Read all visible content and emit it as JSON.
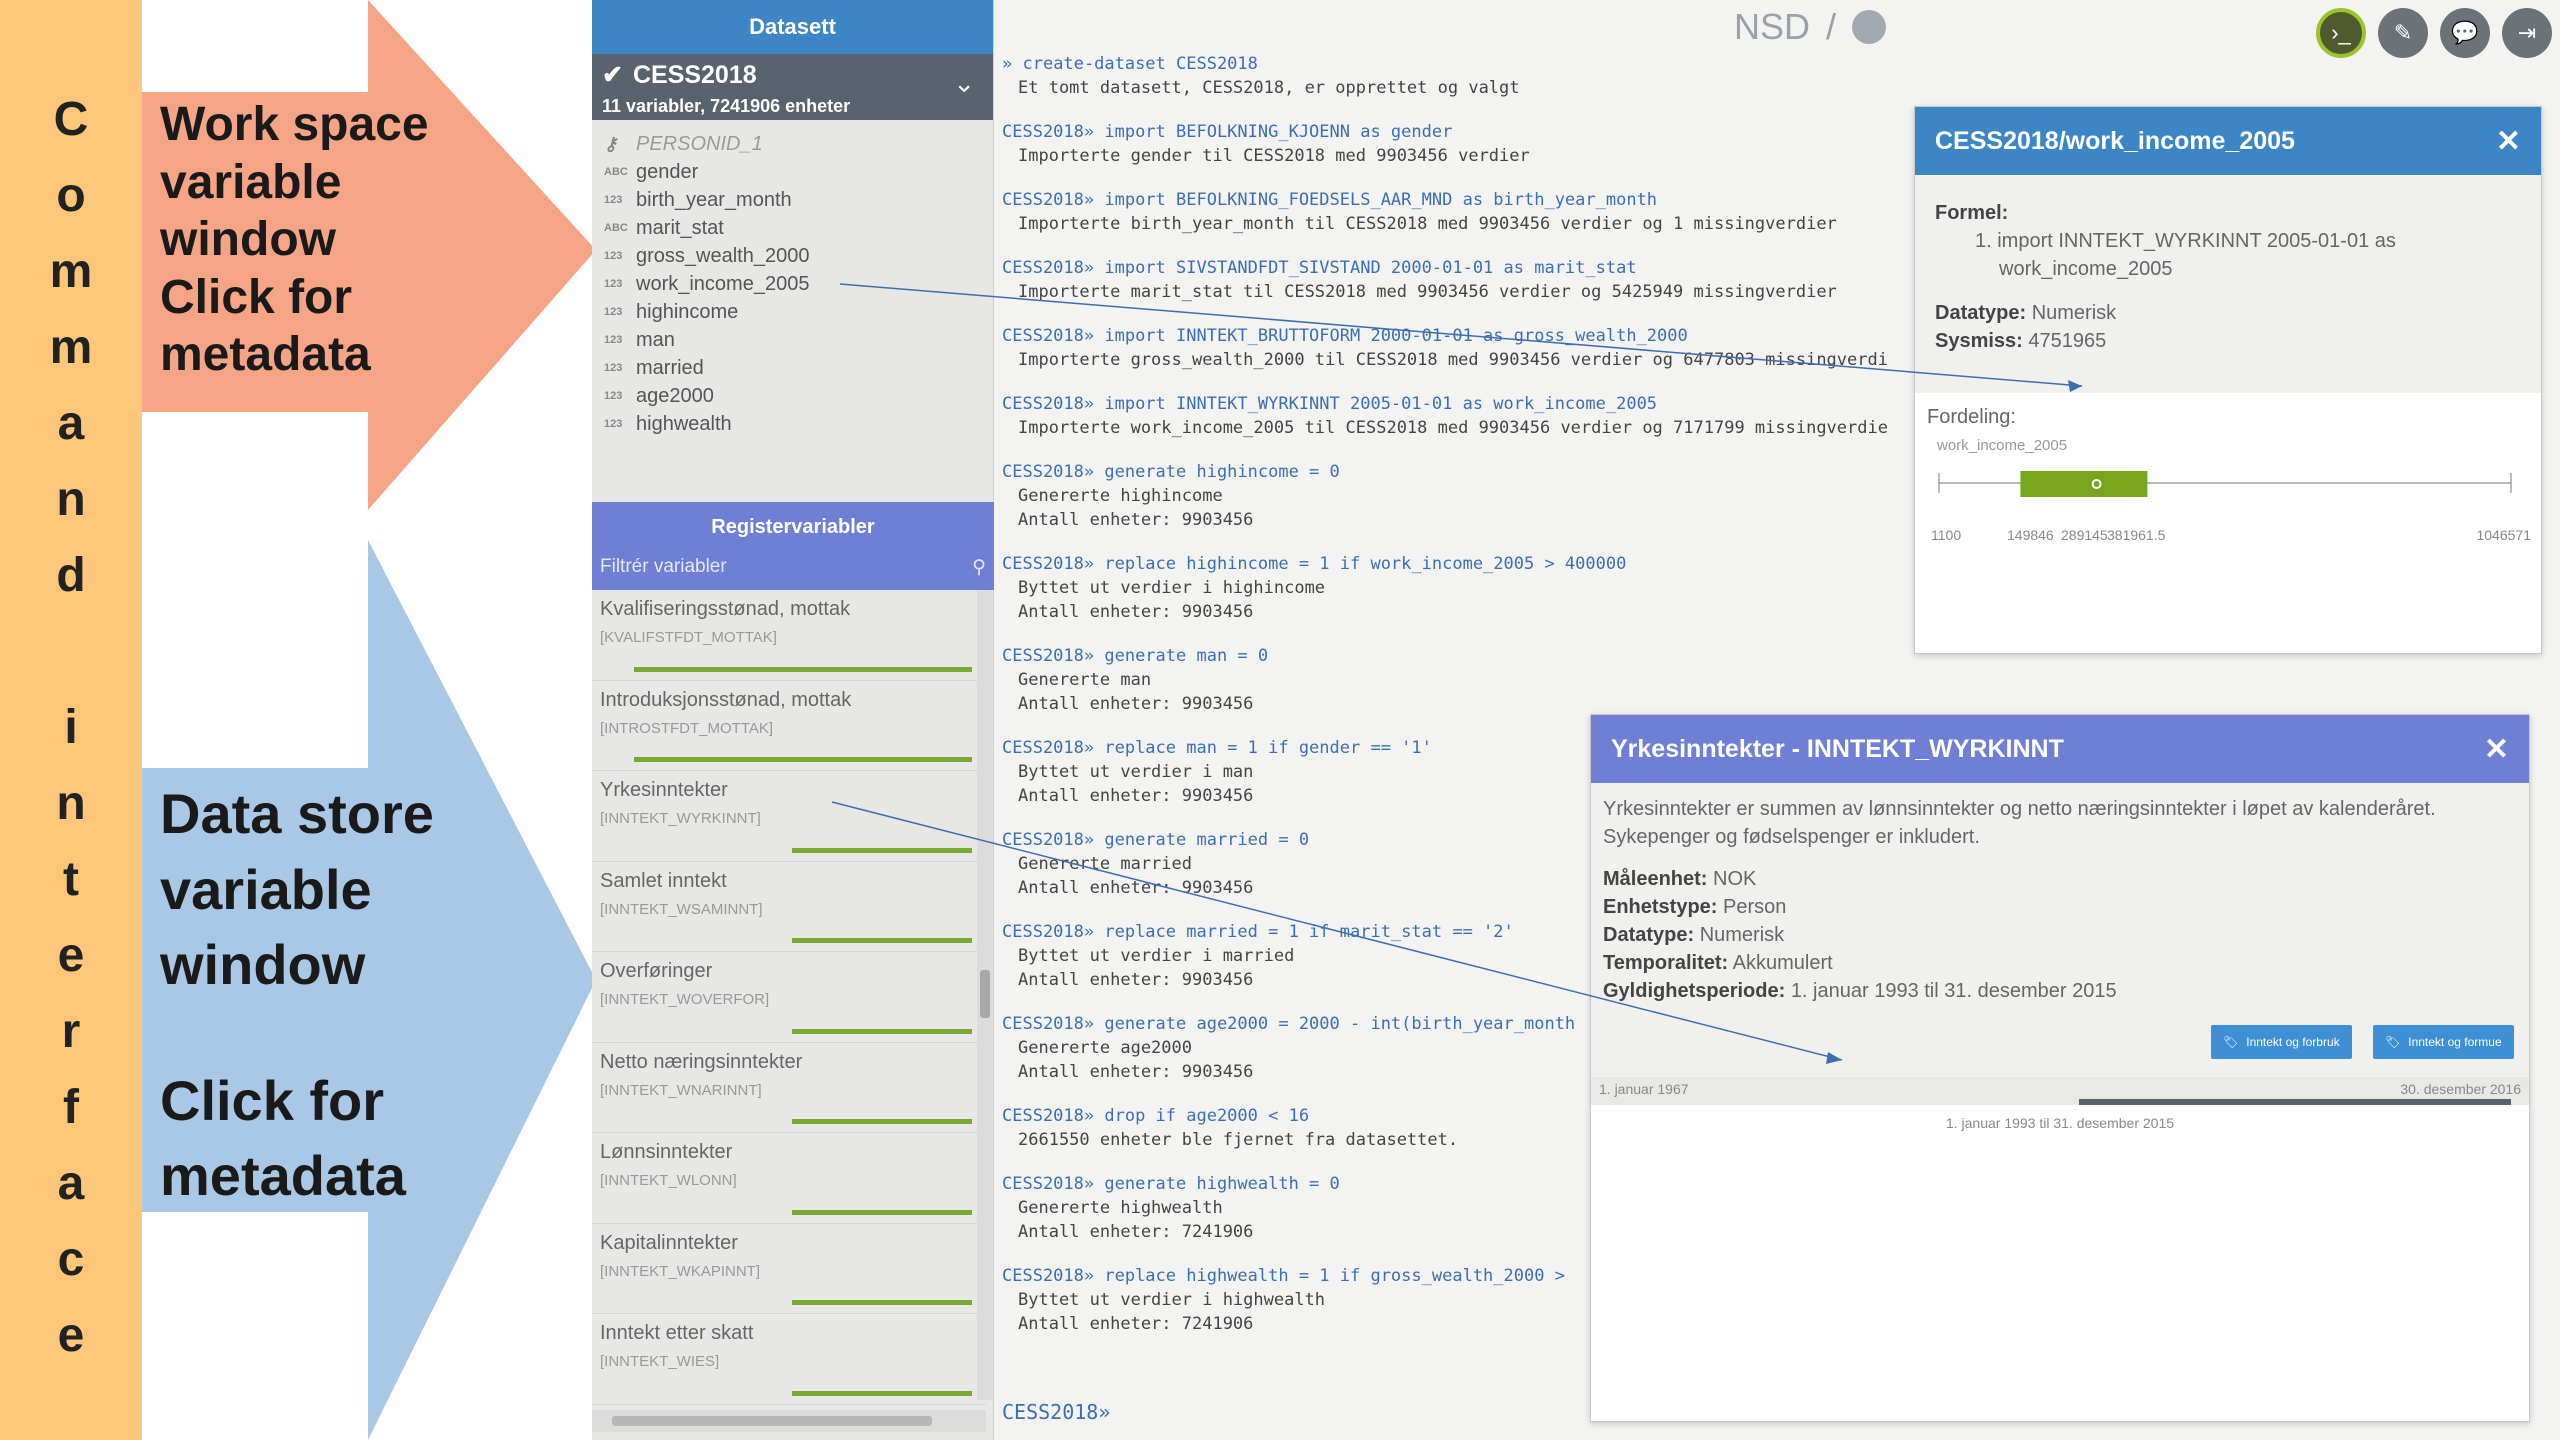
{
  "annotations": {
    "command_letters": [
      "C",
      "o",
      "m",
      "m",
      "a",
      "n",
      "d",
      "",
      "i",
      "n",
      "t",
      "e",
      "r",
      "f",
      "a",
      "c",
      "e"
    ],
    "workspace_label": [
      "Work space",
      "variable",
      "window",
      "Click for",
      "metadata"
    ],
    "datastore_label": [
      "Data store",
      "variable",
      "window",
      "",
      "Click for",
      "metadata"
    ],
    "colors": {
      "command_bar": "#fdc77a",
      "workspace_arrow": "#f5a585",
      "datastore_arrow": "#a8c8e6"
    }
  },
  "dataset": {
    "header": "Datasett",
    "name": "CESS2018",
    "summary": "11 variabler, 7241906 enheter",
    "variables": [
      {
        "type": "key",
        "name": "PERSONID_1"
      },
      {
        "type": "ABC",
        "name": "gender"
      },
      {
        "type": "123",
        "name": "birth_year_month"
      },
      {
        "type": "ABC",
        "name": "marit_stat"
      },
      {
        "type": "123",
        "name": "gross_wealth_2000"
      },
      {
        "type": "123",
        "name": "work_income_2005"
      },
      {
        "type": "123",
        "name": "highincome"
      },
      {
        "type": "123",
        "name": "man"
      },
      {
        "type": "123",
        "name": "married"
      },
      {
        "type": "123",
        "name": "age2000"
      },
      {
        "type": "123",
        "name": "highwealth"
      }
    ]
  },
  "register": {
    "header": "Registervariabler",
    "filter_placeholder": "Filtrér variabler",
    "items": [
      {
        "name": "Kvalifiseringsstønad, mottak",
        "code": "[KVALIFSTFDT_MOTTAK]",
        "coverage": 0.94
      },
      {
        "name": "Introduksjonsstønad, mottak",
        "code": "[INTROSTFDT_MOTTAK]",
        "coverage": 0.94
      },
      {
        "name": "Yrkesinntekter",
        "code": "[INNTEKT_WYRKINNT]",
        "coverage": 0.5
      },
      {
        "name": "Samlet inntekt",
        "code": "[INNTEKT_WSAMINNT]",
        "coverage": 0.5
      },
      {
        "name": "Overføringer",
        "code": "[INNTEKT_WOVERFOR]",
        "coverage": 0.5
      },
      {
        "name": "Netto næringsinntekter",
        "code": "[INNTEKT_WNARINNT]",
        "coverage": 0.5
      },
      {
        "name": "Lønnsinntekter",
        "code": "[INNTEKT_WLONN]",
        "coverage": 0.5
      },
      {
        "name": "Kapitalinntekter",
        "code": "[INNTEKT_WKAPINNT]",
        "coverage": 0.5
      },
      {
        "name": "Inntekt etter skatt",
        "code": "[INNTEKT_WIES]",
        "coverage": 0.5
      }
    ]
  },
  "topbar": {
    "brand": "NSD",
    "separator": "/"
  },
  "console": {
    "blocks": [
      {
        "prompt": "»",
        "cmd": " create-dataset CESS2018",
        "out": [
          "Et tomt datasett, CESS2018, er opprettet og valgt"
        ]
      },
      {
        "prompt": "CESS2018»",
        "cmd": " import BEFOLKNING_KJOENN as gender",
        "out": [
          "Importerte gender til CESS2018 med 9903456 verdier"
        ]
      },
      {
        "prompt": "CESS2018»",
        "cmd": " import BEFOLKNING_FOEDSELS_AAR_MND as birth_year_month",
        "out": [
          "Importerte birth_year_month til CESS2018 med 9903456 verdier og 1 missingverdier"
        ]
      },
      {
        "prompt": "CESS2018»",
        "cmd": " import SIVSTANDFDT_SIVSTAND 2000-01-01 as marit_stat",
        "out": [
          "Importerte marit_stat til CESS2018 med 9903456 verdier og 5425949 missingverdier"
        ]
      },
      {
        "prompt": "CESS2018»",
        "cmd": " import INNTEKT_BRUTTOFORM 2000-01-01 as gross_wealth_2000",
        "out": [
          "Importerte gross_wealth_2000 til CESS2018 med 9903456 verdier og 6477803 missingverdi"
        ]
      },
      {
        "prompt": "CESS2018»",
        "cmd": " import INNTEKT_WYRKINNT 2005-01-01 as work_income_2005",
        "out": [
          "Importerte work_income_2005 til CESS2018 med 9903456 verdier og 7171799 missingverdie"
        ]
      },
      {
        "prompt": "CESS2018»",
        "cmd": " generate highincome = 0",
        "out": [
          "Genererte highincome",
          "Antall enheter: 9903456"
        ]
      },
      {
        "prompt": "CESS2018»",
        "cmd": " replace highincome = 1 if work_income_2005 > 400000",
        "out": [
          "Byttet ut verdier i highincome",
          "Antall enheter: 9903456"
        ]
      },
      {
        "prompt": "CESS2018»",
        "cmd": " generate man = 0",
        "out": [
          "Genererte man",
          "Antall enheter: 9903456"
        ]
      },
      {
        "prompt": "CESS2018»",
        "cmd": " replace man = 1 if gender == '1'",
        "out": [
          "Byttet ut verdier i man",
          "Antall enheter: 9903456"
        ]
      },
      {
        "prompt": "CESS2018»",
        "cmd": " generate married = 0",
        "out": [
          "Genererte married",
          "Antall enheter: 9903456"
        ]
      },
      {
        "prompt": "CESS2018»",
        "cmd": " replace married = 1 if marit_stat == '2'",
        "out": [
          "Byttet ut verdier i married",
          "Antall enheter: 9903456"
        ]
      },
      {
        "prompt": "CESS2018»",
        "cmd": " generate age2000 = 2000 - int(birth_year_month",
        "out": [
          "Genererte age2000",
          "Antall enheter: 9903456"
        ]
      },
      {
        "prompt": "CESS2018»",
        "cmd": " drop if age2000 < 16",
        "out": [
          "2661550 enheter ble fjernet fra datasettet."
        ]
      },
      {
        "prompt": "CESS2018»",
        "cmd": " generate highwealth = 0",
        "out": [
          "Genererte highwealth",
          "Antall enheter: 7241906"
        ]
      },
      {
        "prompt": "CESS2018»",
        "cmd": " replace highwealth = 1 if gross_wealth_2000 >",
        "out": [
          "Byttet ut verdier i highwealth",
          "Antall enheter: 7241906"
        ]
      }
    ],
    "current_prompt": "CESS2018»"
  },
  "popup_workspace": {
    "title": "CESS2018/work_income_2005",
    "formula_label": "Formel:",
    "formula": "1. import INNTEKT_WYRKINNT 2005-01-01 as",
    "formula_cont": "work_income_2005",
    "datatype_label": "Datatype:",
    "datatype": "Numerisk",
    "missing_label": "Sysmiss:",
    "missing": "4751965",
    "distribution_label": "Fordeling:",
    "dist_var": "work_income_2005",
    "dist_min": "1100",
    "dist_q1": "149846",
    "dist_median": "289145",
    "dist_q3": "381961.5",
    "dist_max": "1046571",
    "dist_values": {
      "min": 1100,
      "q1": 149846,
      "median": 289145,
      "q3": 381961.5,
      "max": 1046571
    },
    "header_color": "#3d86c6"
  },
  "popup_store": {
    "title": "Yrkesinntekter - INNTEKT_WYRKINNT",
    "description": "Yrkesinntekter er summen av lønnsinntekter og netto næringsinntekter i løpet av kalenderåret.",
    "description2": "Sykepenger og fødselspenger er inkludert.",
    "unit_label": "Måleenhet:",
    "unit": "NOK",
    "entity_label": "Enhetstype:",
    "entity": "Person",
    "datatype_label": "Datatype:",
    "datatype": "Numerisk",
    "temporal_label": "Temporalitet:",
    "temporal": "Akkumulert",
    "validity_label": "Gyldighetsperiode:",
    "validity": "1. januar 1993 til 31. desember 2015",
    "tag1": "Inntekt og forbruk",
    "tag2": "Inntekt og formue",
    "timeline_start": "1. januar 1967",
    "timeline_end": "30. desember 2016",
    "timeline_caption": "1. januar 1993 til 31. desember 2015",
    "header_color": "#6f7fd4"
  }
}
